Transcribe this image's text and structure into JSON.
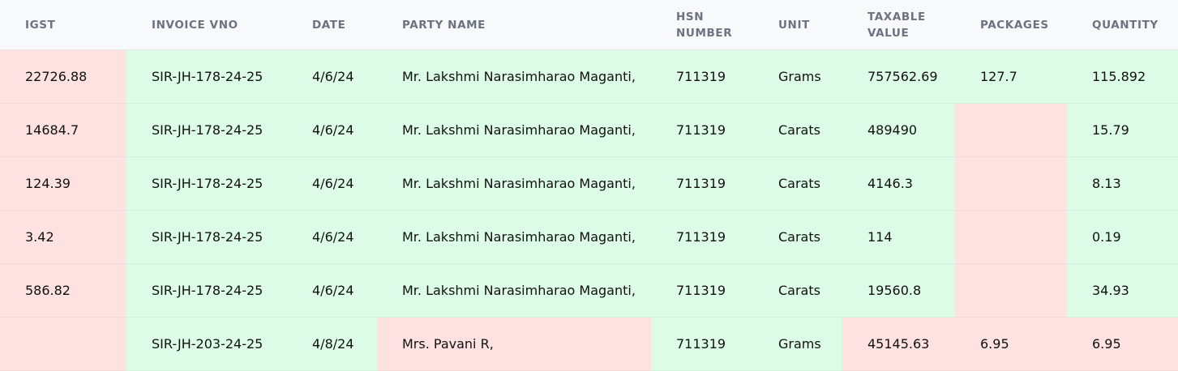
{
  "colors": {
    "green": "#dcfce7",
    "red": "#fee2e2"
  },
  "table": {
    "headers": [
      "IGST",
      "INVOICE VNO",
      "DATE",
      "PARTY NAME",
      "HSN\nNUMBER",
      "UNIT",
      "TAXABLE\nVALUE",
      "PACKAGES",
      "QUANTITY"
    ],
    "rows": [
      {
        "values": [
          "22726.88",
          "SIR-JH-178-24-25",
          "4/6/24",
          "Mr. Lakshmi Narasimharao Maganti,",
          "711319",
          "Grams",
          "757562.69",
          "127.7",
          "115.892"
        ],
        "status": [
          "red",
          "green",
          "green",
          "green",
          "green",
          "green",
          "green",
          "green",
          "green"
        ]
      },
      {
        "values": [
          "14684.7",
          "SIR-JH-178-24-25",
          "4/6/24",
          "Mr. Lakshmi Narasimharao Maganti,",
          "711319",
          "Carats",
          "489490",
          "",
          "15.79"
        ],
        "status": [
          "red",
          "green",
          "green",
          "green",
          "green",
          "green",
          "green",
          "red",
          "green"
        ]
      },
      {
        "values": [
          "124.39",
          "SIR-JH-178-24-25",
          "4/6/24",
          "Mr. Lakshmi Narasimharao Maganti,",
          "711319",
          "Carats",
          "4146.3",
          "",
          "8.13"
        ],
        "status": [
          "red",
          "green",
          "green",
          "green",
          "green",
          "green",
          "green",
          "red",
          "green"
        ]
      },
      {
        "values": [
          "3.42",
          "SIR-JH-178-24-25",
          "4/6/24",
          "Mr. Lakshmi Narasimharao Maganti,",
          "711319",
          "Carats",
          "114",
          "",
          "0.19"
        ],
        "status": [
          "red",
          "green",
          "green",
          "green",
          "green",
          "green",
          "green",
          "red",
          "green"
        ]
      },
      {
        "values": [
          "586.82",
          "SIR-JH-178-24-25",
          "4/6/24",
          "Mr. Lakshmi Narasimharao Maganti,",
          "711319",
          "Carats",
          "19560.8",
          "",
          "34.93"
        ],
        "status": [
          "red",
          "green",
          "green",
          "green",
          "green",
          "green",
          "green",
          "red",
          "green"
        ]
      },
      {
        "values": [
          "",
          "SIR-JH-203-24-25",
          "4/8/24",
          "Mrs. Pavani R,",
          "711319",
          "Grams",
          "45145.63",
          "6.95",
          "6.95"
        ],
        "status": [
          "red",
          "green",
          "green",
          "red",
          "green",
          "green",
          "red",
          "red",
          "red"
        ]
      }
    ]
  }
}
